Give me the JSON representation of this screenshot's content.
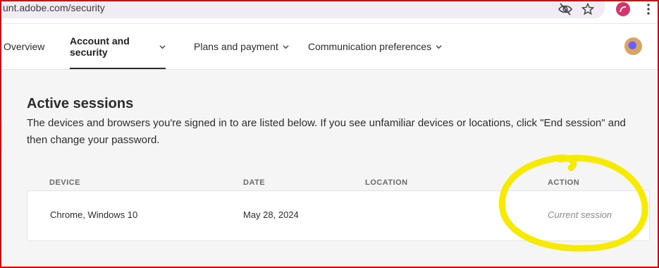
{
  "browser": {
    "url": "unt.adobe.com/security",
    "icons": [
      "eye-off-icon",
      "star-icon",
      "profile-icon",
      "kebab-menu-icon"
    ]
  },
  "nav": {
    "tabs": [
      {
        "label": "Overview",
        "active": false,
        "has_menu": false
      },
      {
        "label": "Account and security",
        "active": true,
        "has_menu": true
      },
      {
        "label": "Plans and payment",
        "active": false,
        "has_menu": true
      },
      {
        "label": "Communication preferences",
        "active": false,
        "has_menu": true
      }
    ]
  },
  "main": {
    "title": "Active sessions",
    "description": "The devices and browsers you're signed in to are listed below. If you see unfamiliar devices or locations, click \"End session\" and then change your password.",
    "table": {
      "headers": [
        "DEVICE",
        "DATE",
        "LOCATION",
        "ACTION"
      ],
      "rows": [
        {
          "device": "Chrome, Windows 10",
          "date": "May 28, 2024",
          "location": "",
          "action": "Current session"
        }
      ]
    }
  },
  "colors": {
    "border_red": "#e00000",
    "highlight_yellow": "#f5ea00",
    "omnibox": "#f1ebf4"
  }
}
